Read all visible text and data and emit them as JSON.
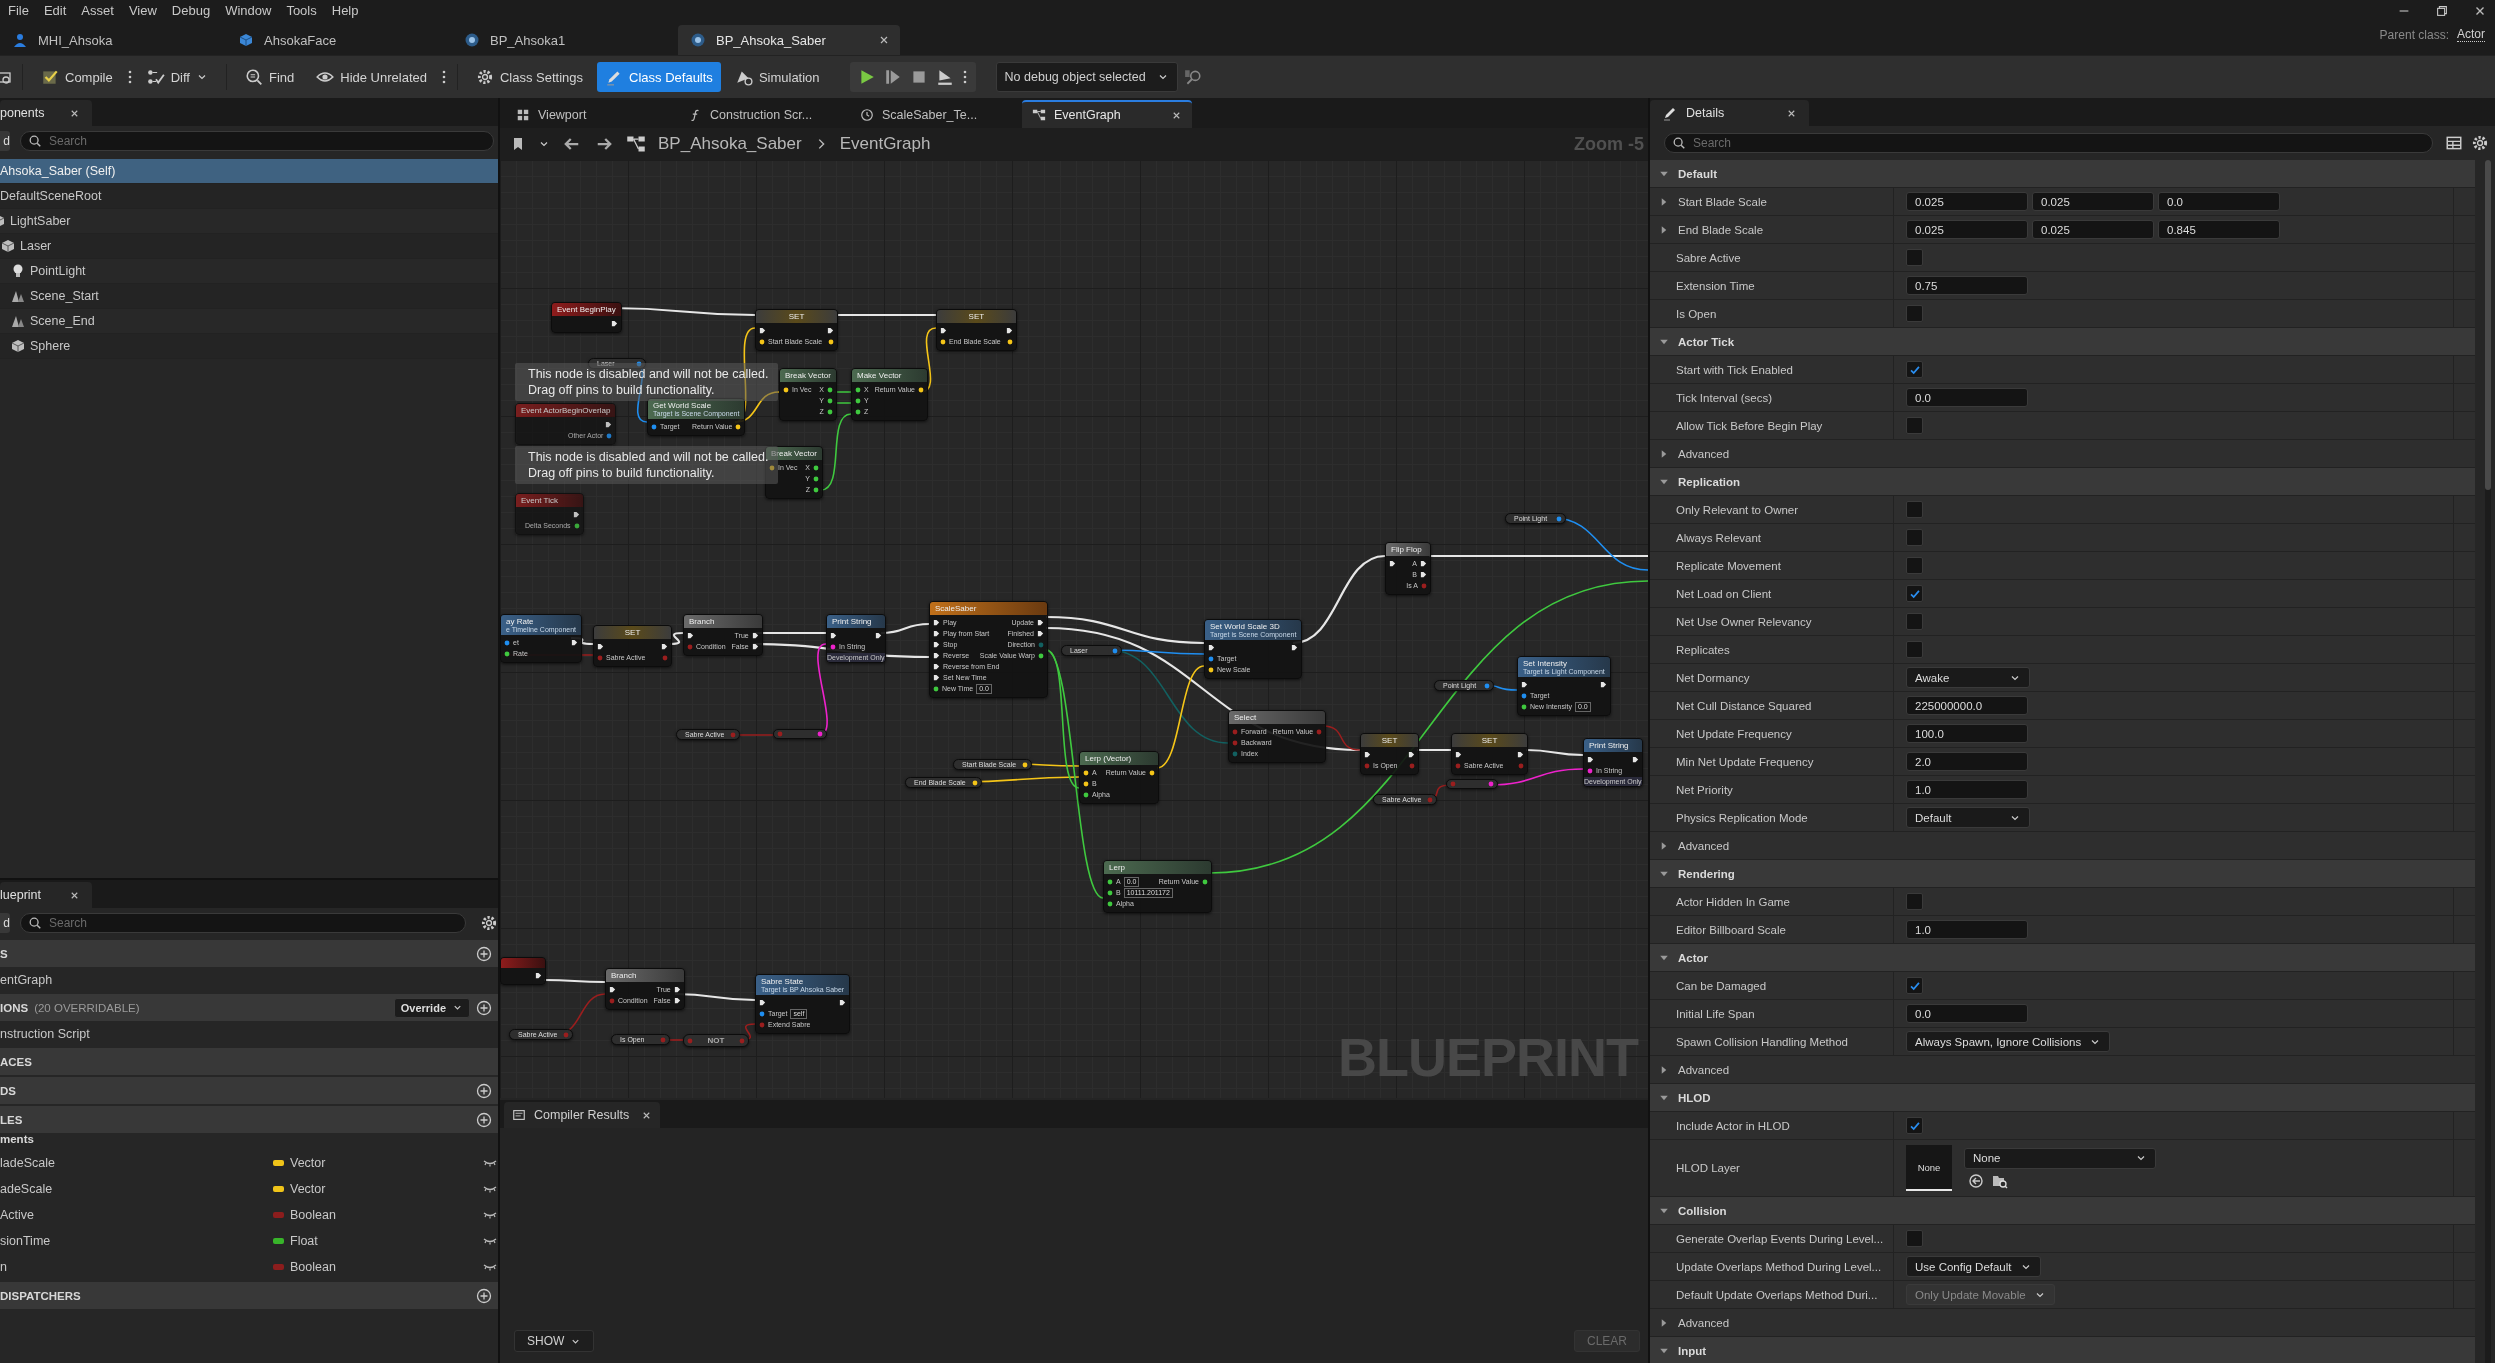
{
  "menu": [
    "File",
    "Edit",
    "Asset",
    "View",
    "Debug",
    "Window",
    "Tools",
    "Help"
  ],
  "asset_tabs": [
    {
      "label": "MHI_Ahsoka",
      "selected": false
    },
    {
      "label": "AhsokaFace",
      "selected": false
    },
    {
      "label": "BP_Ahsoka1",
      "selected": false
    },
    {
      "label": "BP_Ahsoka_Saber",
      "selected": true
    }
  ],
  "parent_class": {
    "label": "Parent class:",
    "value": "Actor"
  },
  "toolbar": {
    "buttons": [
      {
        "label": "Compile",
        "selected": false
      },
      {
        "label": "Diff",
        "selected": false
      },
      {
        "label": "Find",
        "selected": false
      },
      {
        "label": "Hide Unrelated",
        "selected": false
      },
      {
        "label": "Class Settings",
        "selected": false
      },
      {
        "label": "Class Defaults",
        "selected": true
      },
      {
        "label": "Simulation",
        "selected": false
      }
    ],
    "debug_object": "No debug object selected"
  },
  "components": {
    "tab": "ponents",
    "add_button": "d",
    "search_placeholder": "Search",
    "tree": [
      {
        "label": "Ahsoka_Saber (Self)",
        "selected": true,
        "children": [
          {
            "label": "DefaultSceneRoot",
            "selected": false,
            "children": [
              {
                "label": "LightSaber",
                "kind": "mesh",
                "selected": false,
                "children": [
                  {
                    "label": "Laser",
                    "kind": "mesh",
                    "selected": false,
                    "children": [
                      {
                        "label": "PointLight",
                        "kind": "light",
                        "selected": false
                      },
                      {
                        "label": "Scene_Start",
                        "kind": "arrow",
                        "selected": false
                      },
                      {
                        "label": "Scene_End",
                        "kind": "arrow",
                        "selected": false
                      },
                      {
                        "label": "Sphere",
                        "kind": "mesh",
                        "selected": false
                      }
                    ]
                  }
                ]
              }
            ]
          }
        ]
      }
    ]
  },
  "my_blueprint": {
    "tab": "lueprint",
    "add_button": "d",
    "search_placeholder": "Search",
    "sections": [
      {
        "title": "S",
        "add": true,
        "items": [
          "entGraph"
        ]
      },
      {
        "title": "IONS",
        "note": "(20 OVERRIDABLE)",
        "dropdown": "Override",
        "add": true,
        "items": [
          "nstruction Script"
        ]
      },
      {
        "title": "ACES",
        "add": false
      },
      {
        "title": "DS",
        "add": true
      },
      {
        "title": "LES",
        "add": true,
        "category": "ments",
        "variables": [
          {
            "name": "ladeScale",
            "type": "Vector",
            "color": "#f0c419"
          },
          {
            "name": "adeScale",
            "type": "Vector",
            "color": "#f0c419"
          },
          {
            "name": "Active",
            "type": "Boolean",
            "color": "#8c1d1d"
          },
          {
            "name": "sionTime",
            "type": "Float",
            "color": "#38b42a"
          },
          {
            "name": "n",
            "type": "Boolean",
            "color": "#8c1d1d"
          }
        ]
      },
      {
        "title": "DISPATCHERS",
        "add": true
      }
    ]
  },
  "graph": {
    "tabs": [
      {
        "label": "Viewport",
        "selected": false
      },
      {
        "label": "Construction Scr...",
        "selected": false
      },
      {
        "label": "ScaleSaber_Te...",
        "selected": false
      },
      {
        "label": "EventGraph",
        "selected": true
      }
    ],
    "breadcrumb": [
      "BP_Ahsoka_Saber",
      "EventGraph"
    ],
    "zoom": "Zoom -5",
    "nodes": [
      {
        "kind": "event",
        "title": "Event BeginPlay",
        "disabled": false,
        "out": [
          {
            "kind": "exec"
          }
        ]
      },
      {
        "kind": "set",
        "title": "SET",
        "disabled": false,
        "in": [
          {
            "kind": "exec"
          },
          {
            "kind": "vector",
            "label": "Start Blade Scale"
          }
        ],
        "out": [
          {
            "kind": "exec"
          },
          {
            "kind": "vector"
          }
        ]
      },
      {
        "kind": "set",
        "title": "SET",
        "disabled": false,
        "in": [
          {
            "kind": "exec"
          },
          {
            "kind": "vector",
            "label": "End Blade Scale"
          }
        ],
        "out": [
          {
            "kind": "exec"
          },
          {
            "kind": "vector"
          }
        ]
      },
      {
        "kind": "getter",
        "title": "Laser",
        "disabled": false,
        "out": [
          {
            "kind": "object"
          }
        ]
      },
      {
        "kind": "pure",
        "title": "Get World Scale",
        "subtitle": "Target is Scene Component",
        "disabled": false,
        "in": [
          {
            "kind": "object",
            "label": "Target"
          }
        ],
        "out": [
          {
            "kind": "vector",
            "label": "Return Value"
          }
        ]
      },
      {
        "kind": "pure",
        "title": "Break Vector",
        "disabled": false,
        "in": [
          {
            "kind": "vector",
            "label": "In Vec"
          }
        ],
        "out": [
          {
            "kind": "float",
            "label": "X"
          },
          {
            "kind": "float",
            "label": "Y"
          },
          {
            "kind": "float",
            "label": "Z"
          }
        ]
      },
      {
        "kind": "pure",
        "title": "Make Vector",
        "disabled": false,
        "in": [
          {
            "kind": "float",
            "label": "X"
          },
          {
            "kind": "float",
            "label": "Y"
          },
          {
            "kind": "float",
            "label": "Z"
          }
        ],
        "out": [
          {
            "kind": "vector",
            "label": "Return Value"
          }
        ]
      },
      {
        "kind": "event",
        "title": "Event ActorBeginOverlap",
        "disabled": true,
        "out": [
          {
            "kind": "exec"
          },
          {
            "kind": "object",
            "label": "Other Actor"
          }
        ]
      },
      {
        "kind": "pure",
        "title": "Break Vector",
        "disabled": false,
        "in": [
          {
            "kind": "vector",
            "label": "In Vec"
          }
        ],
        "out": [
          {
            "kind": "float",
            "label": "X"
          },
          {
            "kind": "float",
            "label": "Y"
          },
          {
            "kind": "float",
            "label": "Z"
          }
        ]
      },
      {
        "kind": "event",
        "title": "Event Tick",
        "disabled": true,
        "out": [
          {
            "kind": "exec"
          },
          {
            "kind": "float",
            "label": "Delta Seconds"
          }
        ]
      },
      {
        "kind": "call",
        "title": "ay Rate",
        "subtitle": "e Timeline Component",
        "disabled": false,
        "in": [
          {
            "kind": "object",
            "label": "et"
          },
          {
            "kind": "float",
            "label": "Rate"
          }
        ],
        "out": [
          {
            "kind": "exec"
          }
        ]
      },
      {
        "kind": "set",
        "title": "SET",
        "disabled": false,
        "in": [
          {
            "kind": "exec"
          },
          {
            "kind": "bool",
            "label": "Sabre Active"
          }
        ],
        "out": [
          {
            "kind": "exec"
          },
          {
            "kind": "bool"
          }
        ]
      },
      {
        "kind": "flow",
        "title": "Branch",
        "disabled": false,
        "in": [
          {
            "kind": "exec"
          },
          {
            "kind": "bool",
            "label": "Condition"
          }
        ],
        "out": [
          {
            "kind": "exec",
            "label": "True"
          },
          {
            "kind": "exec",
            "label": "False"
          }
        ]
      },
      {
        "kind": "call",
        "title": "Print String",
        "footer": "Development Only",
        "disabled": false,
        "in": [
          {
            "kind": "exec"
          },
          {
            "kind": "string",
            "label": "In String"
          }
        ],
        "out": [
          {
            "kind": "exec"
          }
        ]
      },
      {
        "kind": "timeline",
        "title": "ScaleSaber",
        "disabled": false,
        "in": [
          {
            "kind": "exec",
            "label": "Play"
          },
          {
            "kind": "exec",
            "label": "Play from Start"
          },
          {
            "kind": "exec",
            "label": "Stop"
          },
          {
            "kind": "exec",
            "label": "Reverse"
          },
          {
            "kind": "exec",
            "label": "Reverse from End"
          },
          {
            "kind": "exec",
            "label": "Set New Time"
          },
          {
            "kind": "float",
            "label": "New Time",
            "value": "0.0"
          }
        ],
        "out": [
          {
            "kind": "exec",
            "label": "Update"
          },
          {
            "kind": "exec",
            "label": "Finished"
          },
          {
            "kind": "enum",
            "label": "Direction"
          },
          {
            "kind": "float",
            "label": "Scale Value Warp"
          }
        ]
      },
      {
        "kind": "getter",
        "title": "Laser",
        "disabled": false,
        "out": [
          {
            "kind": "object"
          }
        ]
      },
      {
        "kind": "call",
        "title": "Set World Scale 3D",
        "subtitle": "Target is Scene Component",
        "disabled": false,
        "in": [
          {
            "kind": "exec"
          },
          {
            "kind": "object",
            "label": "Target"
          },
          {
            "kind": "vector",
            "label": "New Scale"
          }
        ],
        "out": [
          {
            "kind": "exec"
          }
        ]
      },
      {
        "kind": "flow",
        "title": "Flip Flop",
        "disabled": false,
        "in": [
          {
            "kind": "exec"
          }
        ],
        "out": [
          {
            "kind": "exec",
            "label": "A"
          },
          {
            "kind": "exec",
            "label": "B"
          },
          {
            "kind": "bool",
            "label": "Is A"
          }
        ]
      },
      {
        "kind": "getter",
        "title": "Point Light",
        "disabled": false,
        "out": [
          {
            "kind": "object"
          }
        ]
      },
      {
        "kind": "getter",
        "title": "Point Light",
        "disabled": false,
        "out": [
          {
            "kind": "object"
          }
        ]
      },
      {
        "kind": "call",
        "title": "Set Intensity",
        "subtitle": "Target is Light Component",
        "disabled": false,
        "in": [
          {
            "kind": "exec"
          },
          {
            "kind": "object",
            "label": "Target"
          },
          {
            "kind": "float",
            "label": "New Intensity",
            "value": "0.0"
          }
        ],
        "out": [
          {
            "kind": "exec"
          }
        ]
      },
      {
        "kind": "flow",
        "title": "Select",
        "disabled": false,
        "in": [
          {
            "kind": "bool",
            "label": "Forward"
          },
          {
            "kind": "bool",
            "label": "Backward"
          },
          {
            "kind": "enum",
            "label": "Index"
          }
        ],
        "out": [
          {
            "kind": "bool",
            "label": "Return Value"
          }
        ]
      },
      {
        "kind": "set",
        "title": "SET",
        "disabled": false,
        "in": [
          {
            "kind": "exec"
          },
          {
            "kind": "bool",
            "label": "Is Open"
          }
        ],
        "out": [
          {
            "kind": "exec"
          },
          {
            "kind": "bool"
          }
        ]
      },
      {
        "kind": "set",
        "title": "SET",
        "disabled": false,
        "in": [
          {
            "kind": "exec"
          },
          {
            "kind": "bool",
            "label": "Sabre Active"
          }
        ],
        "out": [
          {
            "kind": "exec"
          },
          {
            "kind": "bool"
          }
        ]
      },
      {
        "kind": "call",
        "title": "Print String",
        "footer": "Development Only",
        "disabled": false,
        "in": [
          {
            "kind": "exec"
          },
          {
            "kind": "string",
            "label": "In String"
          }
        ],
        "out": [
          {
            "kind": "exec"
          }
        ]
      },
      {
        "kind": "getter",
        "title": "Sabre Active",
        "disabled": false,
        "out": [
          {
            "kind": "bool"
          }
        ]
      },
      {
        "kind": "operator",
        "disabled": false,
        "in": [
          {
            "kind": "bool"
          }
        ],
        "out": [
          {
            "kind": "string"
          }
        ]
      },
      {
        "kind": "getter",
        "title": "Sabre Active",
        "disabled": false,
        "out": [
          {
            "kind": "bool"
          }
        ]
      },
      {
        "kind": "operator",
        "disabled": false,
        "in": [
          {
            "kind": "bool"
          }
        ],
        "out": [
          {
            "kind": "string"
          }
        ]
      },
      {
        "kind": "getter",
        "title": "Start Blade Scale",
        "disabled": false,
        "out": [
          {
            "kind": "vector"
          }
        ]
      },
      {
        "kind": "getter",
        "title": "End Blade Scale",
        "disabled": false,
        "out": [
          {
            "kind": "vector"
          }
        ]
      },
      {
        "kind": "pure",
        "title": "Lerp (Vector)",
        "disabled": false,
        "in": [
          {
            "kind": "vector",
            "label": "A"
          },
          {
            "kind": "vector",
            "label": "B"
          },
          {
            "kind": "float",
            "label": "Alpha"
          }
        ],
        "out": [
          {
            "kind": "vector",
            "label": "Return Value"
          }
        ]
      },
      {
        "kind": "pure",
        "title": "Lerp",
        "disabled": false,
        "in": [
          {
            "kind": "float",
            "label": "A",
            "value": "0.0"
          },
          {
            "kind": "float",
            "label": "B",
            "value": "10111.201172"
          },
          {
            "kind": "float",
            "label": "Alpha"
          }
        ],
        "out": [
          {
            "kind": "float",
            "label": "Return Value"
          }
        ]
      },
      {
        "kind": "event",
        "disabled": false,
        "out": [
          {
            "kind": "exec"
          }
        ]
      },
      {
        "kind": "flow",
        "title": "Branch",
        "disabled": false,
        "in": [
          {
            "kind": "exec"
          },
          {
            "kind": "bool",
            "label": "Condition"
          }
        ],
        "out": [
          {
            "kind": "exec",
            "label": "True"
          },
          {
            "kind": "exec",
            "label": "False"
          }
        ]
      },
      {
        "kind": "call",
        "title": "Sabre State",
        "subtitle": "Target is BP Ahsoka Saber",
        "disabled": false,
        "in": [
          {
            "kind": "exec"
          },
          {
            "kind": "object",
            "label": "Target",
            "value": "self"
          },
          {
            "kind": "bool",
            "label": "Extend Sabre"
          }
        ],
        "out": [
          {
            "kind": "exec"
          }
        ]
      },
      {
        "kind": "getter",
        "title": "Sabre Active",
        "disabled": false,
        "out": [
          {
            "kind": "bool"
          }
        ]
      },
      {
        "kind": "getter",
        "title": "Is Open",
        "disabled": false,
        "out": [
          {
            "kind": "bool"
          }
        ]
      },
      {
        "kind": "operator",
        "title": "NOT",
        "disabled": false,
        "in": [
          {
            "kind": "bool"
          }
        ],
        "out": [
          {
            "kind": "bool"
          }
        ]
      }
    ],
    "notices": [
      "This node is disabled and will not be called.\nDrag off pins to build functionality.",
      "This node is disabled and will not be called.\nDrag off pins to build functionality."
    ],
    "watermark": "BLUEPRINT"
  },
  "compiler": {
    "tab": "Compiler Results",
    "show_button": "SHOW",
    "clear_button": "CLEAR"
  },
  "details": {
    "tab": "Details",
    "search_placeholder": "Search",
    "rows": [
      {
        "kind": "section",
        "label": "Default",
        "expanded": true
      },
      {
        "kind": "vector",
        "label": "Start Blade Scale",
        "expanded": false,
        "values": [
          "0.025",
          "0.025",
          "0.0"
        ]
      },
      {
        "kind": "vector",
        "label": "End Blade Scale",
        "expanded": false,
        "values": [
          "0.025",
          "0.025",
          "0.845"
        ]
      },
      {
        "kind": "check",
        "label": "Sabre Active",
        "checked": false
      },
      {
        "kind": "number",
        "label": "Extension Time",
        "value": "0.75"
      },
      {
        "kind": "check",
        "label": "Is Open",
        "checked": false
      },
      {
        "kind": "section",
        "label": "Actor Tick",
        "expanded": true
      },
      {
        "kind": "check",
        "label": "Start with Tick Enabled",
        "checked": true
      },
      {
        "kind": "number",
        "label": "Tick Interval (secs)",
        "value": "0.0"
      },
      {
        "kind": "check",
        "label": "Allow Tick Before Begin Play",
        "checked": false
      },
      {
        "kind": "group",
        "label": "Advanced",
        "expanded": false
      },
      {
        "kind": "section",
        "label": "Replication",
        "expanded": true
      },
      {
        "kind": "check",
        "label": "Only Relevant to Owner",
        "checked": false
      },
      {
        "kind": "check",
        "label": "Always Relevant",
        "checked": false
      },
      {
        "kind": "check",
        "label": "Replicate Movement",
        "checked": false
      },
      {
        "kind": "check",
        "label": "Net Load on Client",
        "checked": true
      },
      {
        "kind": "check",
        "label": "Net Use Owner Relevancy",
        "checked": false
      },
      {
        "kind": "check",
        "label": "Replicates",
        "checked": false
      },
      {
        "kind": "dropdown",
        "label": "Net Dormancy",
        "value": "Awake",
        "disabled": false
      },
      {
        "kind": "number",
        "label": "Net Cull Distance Squared",
        "value": "225000000.0"
      },
      {
        "kind": "number",
        "label": "Net Update Frequency",
        "value": "100.0"
      },
      {
        "kind": "number",
        "label": "Min Net Update Frequency",
        "value": "2.0"
      },
      {
        "kind": "number",
        "label": "Net Priority",
        "value": "1.0"
      },
      {
        "kind": "dropdown",
        "label": "Physics Replication Mode",
        "value": "Default",
        "disabled": false
      },
      {
        "kind": "group",
        "label": "Advanced",
        "expanded": false
      },
      {
        "kind": "section",
        "label": "Rendering",
        "expanded": true
      },
      {
        "kind": "check",
        "label": "Actor Hidden In Game",
        "checked": false
      },
      {
        "kind": "number",
        "label": "Editor Billboard Scale",
        "value": "1.0"
      },
      {
        "kind": "section",
        "label": "Actor",
        "expanded": true
      },
      {
        "kind": "check",
        "label": "Can be Damaged",
        "checked": true
      },
      {
        "kind": "number",
        "label": "Initial Life Span",
        "value": "0.0"
      },
      {
        "kind": "dropdown",
        "label": "Spawn Collision Handling Method",
        "value": "Always Spawn, Ignore Collisions",
        "disabled": false
      },
      {
        "kind": "group",
        "label": "Advanced",
        "expanded": false
      },
      {
        "kind": "section",
        "label": "HLOD",
        "expanded": true
      },
      {
        "kind": "check",
        "label": "Include Actor in HLOD",
        "checked": true
      },
      {
        "kind": "asset",
        "label": "HLOD Layer",
        "thumbnail": "None",
        "value": "None"
      },
      {
        "kind": "section",
        "label": "Collision",
        "expanded": true
      },
      {
        "kind": "check",
        "label": "Generate Overlap Events During Level...",
        "checked": false
      },
      {
        "kind": "dropdown",
        "label": "Update Overlaps Method During Level...",
        "value": "Use Config Default",
        "disabled": false
      },
      {
        "kind": "dropdown",
        "label": "Default Update Overlaps Method Duri...",
        "value": "Only Update Movable",
        "disabled": true
      },
      {
        "kind": "group",
        "label": "Advanced",
        "expanded": false
      },
      {
        "kind": "section",
        "label": "Input",
        "expanded": true
      }
    ]
  }
}
